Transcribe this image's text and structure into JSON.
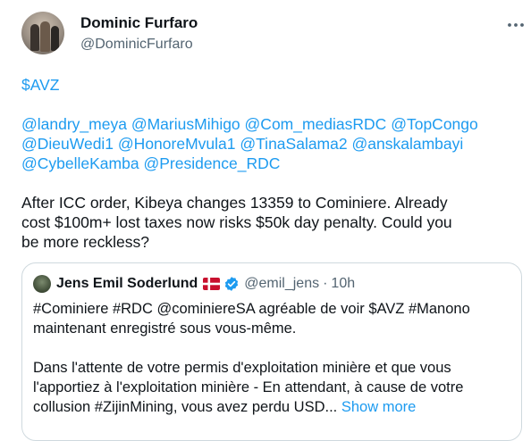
{
  "author": {
    "name": "Dominic Furfaro",
    "handle": "@DominicFurfaro"
  },
  "tweet": {
    "cashtag": "$AVZ",
    "mention_lines": [
      [
        "@landry_meya",
        "@MariusMihigo",
        "@Com_mediasRDC",
        "@TopCongo"
      ],
      [
        "@DieuWedi1",
        "@HonoreMvula1",
        "@TinaSalama2",
        "@anskalambayi"
      ],
      [
        "@CybelleKamba",
        "@Presidence_RDC"
      ]
    ],
    "text_lines": [
      "After ICC order, Kibeya changes 13359 to Cominiere. Already",
      "cost $100m+ lost taxes now risks $50k day penalty. Could you",
      "be more reckless?"
    ]
  },
  "quote": {
    "name": "Jens Emil Soderlund",
    "handle": "@emil_jens",
    "separator": "·",
    "time": "10h",
    "lines": [
      "#Cominiere #RDC @cominiereSA agréable de voir $AVZ #Manono",
      "maintenant enregistré sous vous-même.",
      "",
      "Dans l'attente de votre permis d'exploitation minière et que vous",
      "l'apportiez à l'exploitation minière - En attendant, à cause de votre",
      "collusion #ZijinMining, vous avez perdu USD..."
    ],
    "show_more": "Show more"
  },
  "icons": {
    "more": "more-horizontal-icon",
    "flag": "denmark-flag-icon",
    "verified": "verified-badge-icon"
  },
  "colors": {
    "link": "#1d9bf0",
    "secondary_text": "#536471",
    "border": "#cfd9de",
    "verified": "#1d9bf0",
    "flag_red": "#c8102e"
  }
}
